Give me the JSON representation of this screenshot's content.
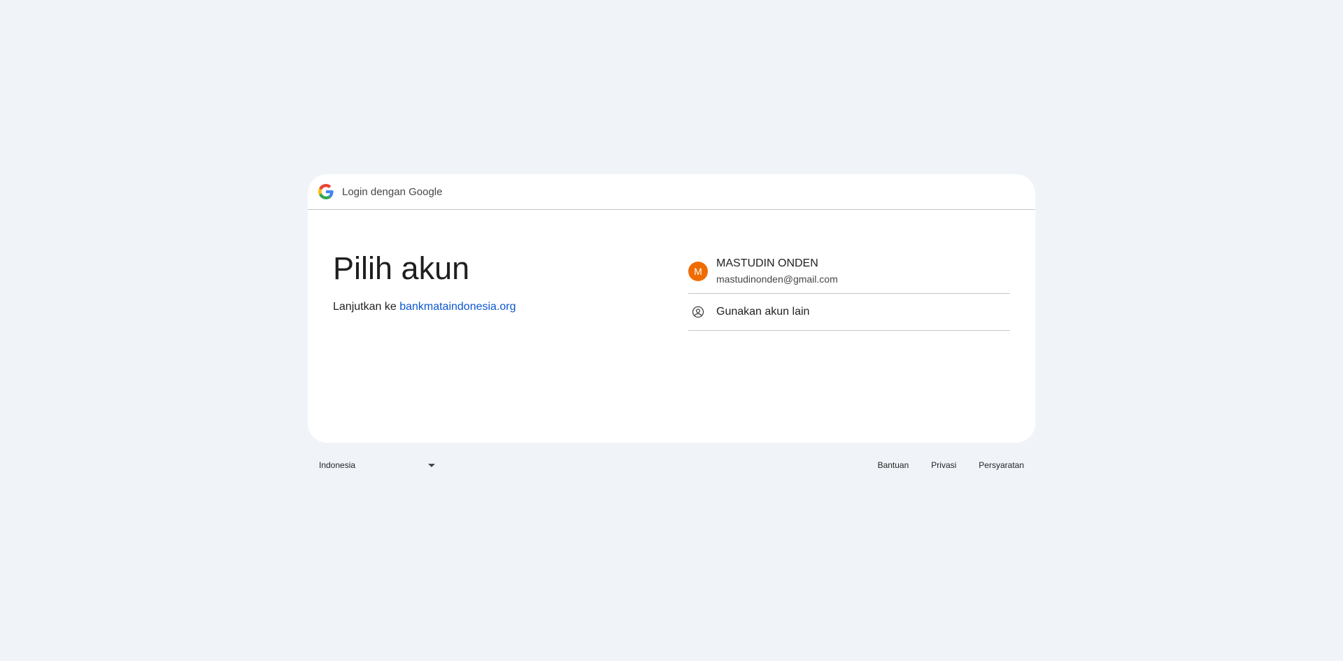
{
  "header": {
    "title": "Login dengan Google"
  },
  "main": {
    "title": "Pilih akun",
    "continue_prefix": "Lanjutkan ke",
    "continue_link": "bankmataindonesia.org"
  },
  "accounts": [
    {
      "initial": "M",
      "name": "MASTUDIN ONDEN",
      "email": "mastudinonden@gmail.com",
      "avatar_color": "#ef6c00"
    }
  ],
  "other_account": {
    "label": "Gunakan akun lain",
    "icon": "account-circle-icon"
  },
  "footer": {
    "language": "Indonesia",
    "links": [
      "Bantuan",
      "Privasi",
      "Persyaratan"
    ]
  },
  "colors": {
    "background": "#f0f4f9",
    "link": "#0b57d0",
    "divider": "#c4c7c5"
  }
}
